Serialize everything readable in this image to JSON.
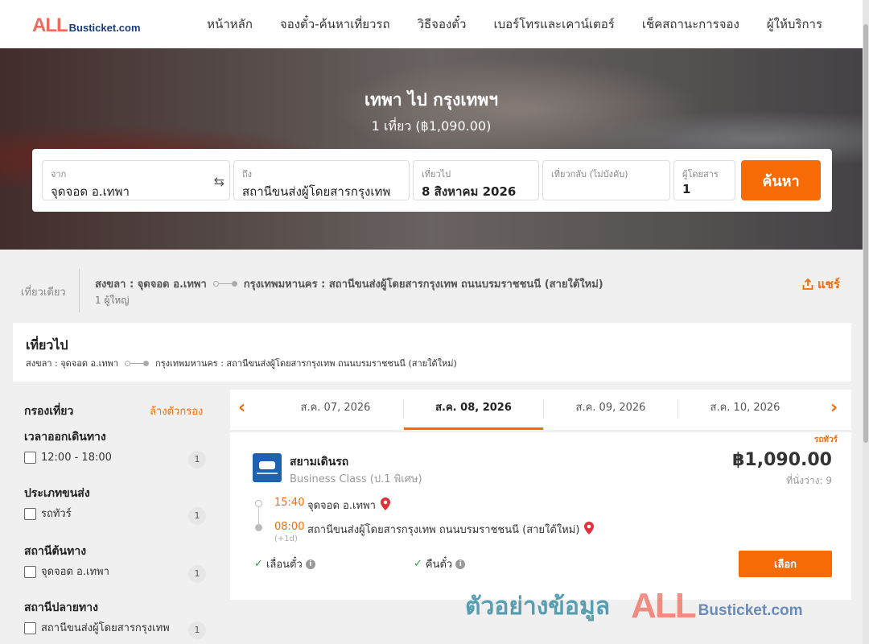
{
  "header": {
    "logo_all": "ALL",
    "logo_rest": "Busticket.com",
    "nav": [
      "หน้าหลัก",
      "จองตั๋ว-ค้นหาเที่ยวรถ",
      "วิธีจองตั๋ว",
      "เบอร์โทรและเคาน์เตอร์",
      "เช็คสถานะการจอง",
      "ผู้ให้บริการ"
    ]
  },
  "hero": {
    "title": "เทพา ไป กรุงเทพฯ",
    "subtitle": "1 เที่ยว (฿1,090.00)"
  },
  "search": {
    "from_label": "จาก",
    "from_value": "จุดจอด อ.เทพา",
    "to_label": "ถึง",
    "to_value": "สถานีขนส่งผู้โดยสารกรุงเทพ",
    "depart_label": "เที่ยวไป",
    "depart_value": "8 สิงหาคม 2026",
    "return_label": "เที่ยวกลับ (ไม่บังคับ)",
    "return_value": "",
    "pax_label": "ผู้โดยสาร",
    "pax_value": "1",
    "button": "ค้นหา"
  },
  "summary": {
    "trip_type": "เที่ยวเดียว",
    "from": "สงขลา : จุดจอด อ.เทพา",
    "to": "กรุงเทพมหานคร : สถานีขนส่งผู้โดยสารกรุงเทพ ถนนบรมราชชนนี (สายใต้ใหม่)",
    "passengers": "1 ผู้ใหญ่",
    "share": "แชร์"
  },
  "outbound": {
    "title": "เที่ยวไป",
    "from": "สงขลา : จุดจอด อ.เทพา",
    "to": "กรุงเทพมหานคร : สถานีขนส่งผู้โดยสารกรุงเทพ ถนนบรมราชชนนี (สายใต้ใหม่)"
  },
  "filters": {
    "title": "กรองเที่ยว",
    "clear": "ล้างตัวกรอง",
    "sections": [
      {
        "title": "เวลาออกเดินทาง",
        "option": "12:00 - 18:00",
        "count": "1"
      },
      {
        "title": "ประเภทขนส่ง",
        "option": "รถทัวร์",
        "count": "1"
      },
      {
        "title": "สถานีต้นทาง",
        "option": "จุดจอด อ.เทพา",
        "count": "1"
      },
      {
        "title": "สถานีปลายทาง",
        "option": "สถานีขนส่งผู้โดยสารกรุงเทพ",
        "count": "1"
      }
    ]
  },
  "dates": [
    "ส.ค. 07, 2026",
    "ส.ค. 08, 2026",
    "ส.ค. 09, 2026",
    "ส.ค. 10, 2026"
  ],
  "trip": {
    "tag": "รถทัวร์",
    "operator": "สยามเดินรถ",
    "class": "Business Class (ป.1 พิเศษ)",
    "price": "฿1,090.00",
    "seats": "ที่นั่งว่าง: 9",
    "depart_time": "15:40",
    "depart_stop": "จุดจอด อ.เทพา",
    "arrive_time": "08:00",
    "arrive_stop": "สถานีขนส่งผู้โดยสารกรุงเทพ ถนนบรมราชชนนี (สายใต้ใหม่)",
    "arrive_offset": "(+1d)",
    "feature1": "เลื่อนตั๋ว",
    "feature2": "คืนตั๋ว",
    "select": "เลือก"
  },
  "watermark": {
    "text": "ตัวอย่างข้อมูล",
    "all": "ALL",
    "rest": "Busticket.com"
  },
  "colors": {
    "accent": "#f76b07",
    "logo_red": "#ee6b5a",
    "logo_blue": "#1a3b7a",
    "check_green": "#2e9b3e"
  }
}
